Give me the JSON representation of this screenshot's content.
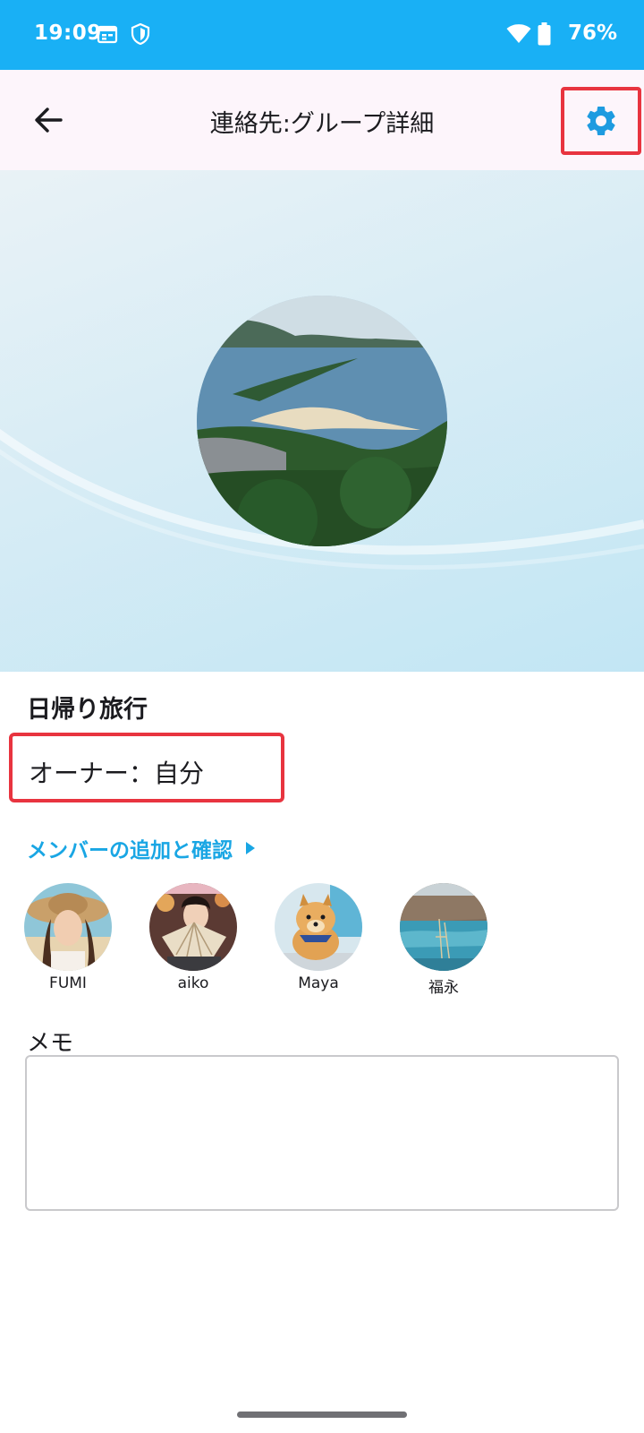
{
  "status_bar": {
    "time": "19:09",
    "battery": "76%",
    "icons": [
      "calendar-icon",
      "shield-icon",
      "wifi-icon",
      "battery-icon"
    ],
    "color": "#19b0f5"
  },
  "app_bar": {
    "title": "連絡先:グループ詳細",
    "back_icon": "arrow-left-icon",
    "settings_icon": "gear-icon",
    "accent": "#1e9be0"
  },
  "group": {
    "name": "日帰り旅行",
    "owner": "オーナー：自分"
  },
  "members_link": {
    "label": "メンバーの追加と確認",
    "icon": "triangle-right-icon",
    "color": "#19a6e4"
  },
  "members": [
    {
      "name": "FUMI"
    },
    {
      "name": "aiko"
    },
    {
      "name": "Maya"
    },
    {
      "name": "福永"
    }
  ],
  "memo": {
    "label": "メモ",
    "value": ""
  },
  "highlight_color": "#e8343f"
}
